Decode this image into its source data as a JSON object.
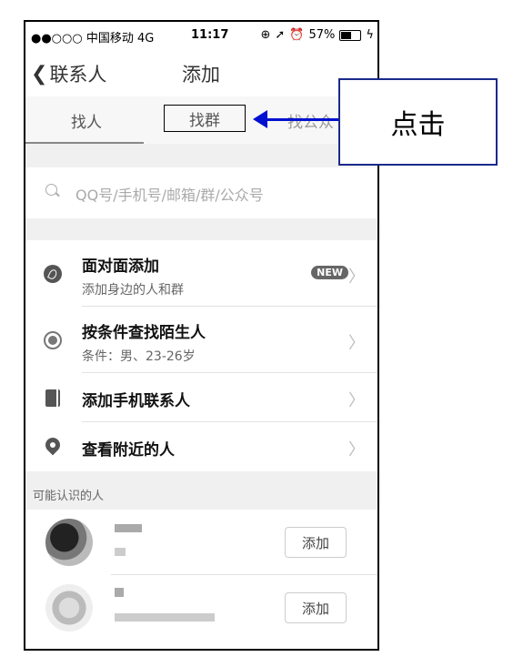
{
  "status_bar": {
    "carrier": "●●○○○ 中国移动 4G",
    "time": "11:17",
    "battery": "57%"
  },
  "nav": {
    "back_label": "联系人",
    "title": "添加"
  },
  "tabs": [
    {
      "label": "找人"
    },
    {
      "label": "找群"
    },
    {
      "label": "找公众"
    }
  ],
  "search": {
    "placeholder": "QQ号/手机号/邮箱/群/公众号"
  },
  "menu": [
    {
      "title": "面对面添加",
      "subtitle": "添加身边的人和群",
      "badge": "NEW",
      "icon": "face-to-face-icon"
    },
    {
      "title": "按条件查找陌生人",
      "subtitle": "条件：男、23-26岁",
      "icon": "filter-search-icon"
    },
    {
      "title": "添加手机联系人",
      "icon": "phone-contacts-icon"
    },
    {
      "title": "查看附近的人",
      "icon": "location-pin-icon"
    }
  ],
  "suggestions": {
    "header": "可能认识的人",
    "add_label": "添加"
  },
  "annotation": {
    "callout_text": "点击",
    "arrow_color": "#0010d0"
  }
}
